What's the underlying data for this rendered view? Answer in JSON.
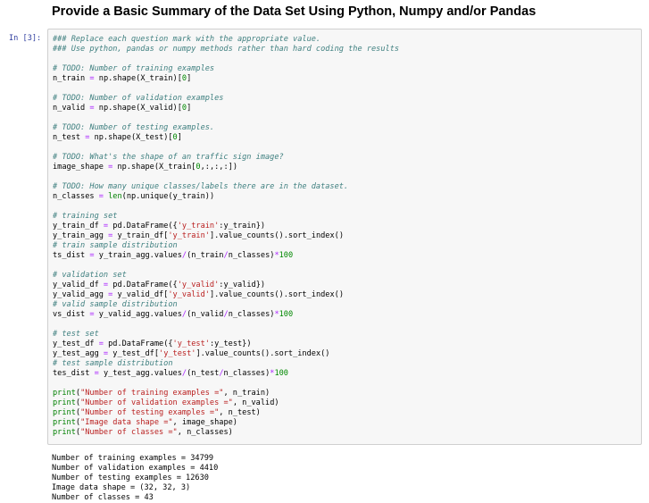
{
  "heading": "Provide a Basic Summary of the Data Set Using Python, Numpy and/or Pandas",
  "cell": {
    "prompt": "In [3]:",
    "code": [
      [
        {
          "c": "cm",
          "t": "### Replace each question mark with the appropriate value."
        }
      ],
      [
        {
          "c": "cm",
          "t": "### Use python, pandas or numpy methods rather than hard coding the results"
        }
      ],
      [],
      [
        {
          "c": "cm",
          "t": "# TODO: Number of training examples"
        }
      ],
      [
        {
          "c": "",
          "t": "n_train "
        },
        {
          "c": "op",
          "t": "="
        },
        {
          "c": "",
          "t": " np.shape(X_train)["
        },
        {
          "c": "nu",
          "t": "0"
        },
        {
          "c": "",
          "t": "]"
        }
      ],
      [],
      [
        {
          "c": "cm",
          "t": "# TODO: Number of validation examples"
        }
      ],
      [
        {
          "c": "",
          "t": "n_valid "
        },
        {
          "c": "op",
          "t": "="
        },
        {
          "c": "",
          "t": " np.shape(X_valid)["
        },
        {
          "c": "nu",
          "t": "0"
        },
        {
          "c": "",
          "t": "]"
        }
      ],
      [],
      [
        {
          "c": "cm",
          "t": "# TODO: Number of testing examples."
        }
      ],
      [
        {
          "c": "",
          "t": "n_test "
        },
        {
          "c": "op",
          "t": "="
        },
        {
          "c": "",
          "t": " np.shape(X_test)["
        },
        {
          "c": "nu",
          "t": "0"
        },
        {
          "c": "",
          "t": "]"
        }
      ],
      [],
      [
        {
          "c": "cm",
          "t": "# TODO: What's the shape of an traffic sign image?"
        }
      ],
      [
        {
          "c": "",
          "t": "image_shape "
        },
        {
          "c": "op",
          "t": "="
        },
        {
          "c": "",
          "t": " np.shape(X_train["
        },
        {
          "c": "nu",
          "t": "0"
        },
        {
          "c": "",
          "t": ",:,:,:])"
        }
      ],
      [],
      [
        {
          "c": "cm",
          "t": "# TODO: How many unique classes/labels there are in the dataset."
        }
      ],
      [
        {
          "c": "",
          "t": "n_classes "
        },
        {
          "c": "op",
          "t": "="
        },
        {
          "c": "",
          "t": " "
        },
        {
          "c": "bi",
          "t": "len"
        },
        {
          "c": "",
          "t": "(np.unique(y_train))"
        }
      ],
      [],
      [
        {
          "c": "cm",
          "t": "# training set"
        }
      ],
      [
        {
          "c": "",
          "t": "y_train_df "
        },
        {
          "c": "op",
          "t": "="
        },
        {
          "c": "",
          "t": " pd.DataFrame({"
        },
        {
          "c": "st",
          "t": "'y_train'"
        },
        {
          "c": "",
          "t": ":y_train})"
        }
      ],
      [
        {
          "c": "",
          "t": "y_train_agg "
        },
        {
          "c": "op",
          "t": "="
        },
        {
          "c": "",
          "t": " y_train_df["
        },
        {
          "c": "st",
          "t": "'y_train'"
        },
        {
          "c": "",
          "t": "].value_counts().sort_index()"
        }
      ],
      [
        {
          "c": "cm",
          "t": "# train sample distribution"
        }
      ],
      [
        {
          "c": "",
          "t": "ts_dist "
        },
        {
          "c": "op",
          "t": "="
        },
        {
          "c": "",
          "t": " y_train_agg.values"
        },
        {
          "c": "op",
          "t": "/"
        },
        {
          "c": "",
          "t": "(n_train"
        },
        {
          "c": "op",
          "t": "/"
        },
        {
          "c": "",
          "t": "n_classes)"
        },
        {
          "c": "op",
          "t": "*"
        },
        {
          "c": "nu",
          "t": "100"
        }
      ],
      [],
      [
        {
          "c": "cm",
          "t": "# validation set"
        }
      ],
      [
        {
          "c": "",
          "t": "y_valid_df "
        },
        {
          "c": "op",
          "t": "="
        },
        {
          "c": "",
          "t": " pd.DataFrame({"
        },
        {
          "c": "st",
          "t": "'y_valid'"
        },
        {
          "c": "",
          "t": ":y_valid})"
        }
      ],
      [
        {
          "c": "",
          "t": "y_valid_agg "
        },
        {
          "c": "op",
          "t": "="
        },
        {
          "c": "",
          "t": " y_valid_df["
        },
        {
          "c": "st",
          "t": "'y_valid'"
        },
        {
          "c": "",
          "t": "].value_counts().sort_index()"
        }
      ],
      [
        {
          "c": "cm",
          "t": "# valid sample distribution"
        }
      ],
      [
        {
          "c": "",
          "t": "vs_dist "
        },
        {
          "c": "op",
          "t": "="
        },
        {
          "c": "",
          "t": " y_valid_agg.values"
        },
        {
          "c": "op",
          "t": "/"
        },
        {
          "c": "",
          "t": "(n_valid"
        },
        {
          "c": "op",
          "t": "/"
        },
        {
          "c": "",
          "t": "n_classes)"
        },
        {
          "c": "op",
          "t": "*"
        },
        {
          "c": "nu",
          "t": "100"
        }
      ],
      [],
      [
        {
          "c": "cm",
          "t": "# test set"
        }
      ],
      [
        {
          "c": "",
          "t": "y_test_df "
        },
        {
          "c": "op",
          "t": "="
        },
        {
          "c": "",
          "t": " pd.DataFrame({"
        },
        {
          "c": "st",
          "t": "'y_test'"
        },
        {
          "c": "",
          "t": ":y_test})"
        }
      ],
      [
        {
          "c": "",
          "t": "y_test_agg "
        },
        {
          "c": "op",
          "t": "="
        },
        {
          "c": "",
          "t": " y_test_df["
        },
        {
          "c": "st",
          "t": "'y_test'"
        },
        {
          "c": "",
          "t": "].value_counts().sort_index()"
        }
      ],
      [
        {
          "c": "cm",
          "t": "# test sample distribution"
        }
      ],
      [
        {
          "c": "",
          "t": "tes_dist "
        },
        {
          "c": "op",
          "t": "="
        },
        {
          "c": "",
          "t": " y_test_agg.values"
        },
        {
          "c": "op",
          "t": "/"
        },
        {
          "c": "",
          "t": "(n_test"
        },
        {
          "c": "op",
          "t": "/"
        },
        {
          "c": "",
          "t": "n_classes)"
        },
        {
          "c": "op",
          "t": "*"
        },
        {
          "c": "nu",
          "t": "100"
        }
      ],
      [],
      [
        {
          "c": "bi",
          "t": "print"
        },
        {
          "c": "",
          "t": "("
        },
        {
          "c": "st",
          "t": "\"Number of training examples =\""
        },
        {
          "c": "",
          "t": ", n_train)"
        }
      ],
      [
        {
          "c": "bi",
          "t": "print"
        },
        {
          "c": "",
          "t": "("
        },
        {
          "c": "st",
          "t": "\"Number of validation examples =\""
        },
        {
          "c": "",
          "t": ", n_valid)"
        }
      ],
      [
        {
          "c": "bi",
          "t": "print"
        },
        {
          "c": "",
          "t": "("
        },
        {
          "c": "st",
          "t": "\"Number of testing examples =\""
        },
        {
          "c": "",
          "t": ", n_test)"
        }
      ],
      [
        {
          "c": "bi",
          "t": "print"
        },
        {
          "c": "",
          "t": "("
        },
        {
          "c": "st",
          "t": "\"Image data shape =\""
        },
        {
          "c": "",
          "t": ", image_shape)"
        }
      ],
      [
        {
          "c": "bi",
          "t": "print"
        },
        {
          "c": "",
          "t": "("
        },
        {
          "c": "st",
          "t": "\"Number of classes =\""
        },
        {
          "c": "",
          "t": ", n_classes)"
        }
      ]
    ],
    "output": [
      "Number of training examples = 34799",
      "Number of validation examples = 4410",
      "Number of testing examples = 12630",
      "Image data shape = (32, 32, 3)",
      "Number of classes = 43"
    ]
  },
  "colors": {
    "comment": "#408080",
    "string": "#ba2121",
    "number": "#008800",
    "operator": "#aa22ff",
    "builtin": "#008000",
    "prompt": "#303f9f",
    "cell_background": "#f7f7f7",
    "cell_border": "#cfcfcf"
  }
}
